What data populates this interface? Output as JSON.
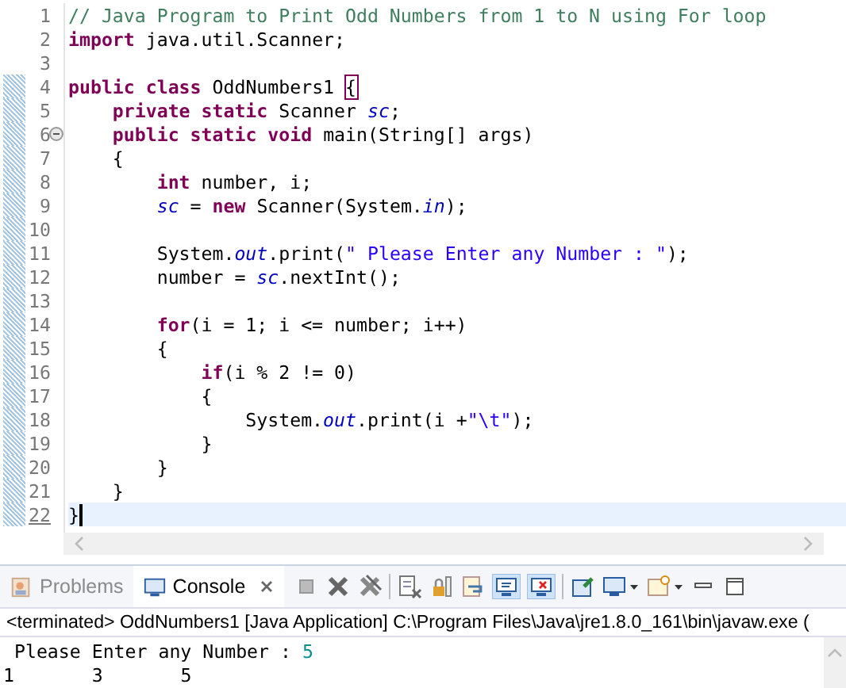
{
  "editor": {
    "lines": [
      {
        "number": "1",
        "changed": false,
        "current": false,
        "tokens": [
          {
            "kind": "comment",
            "text": "// Java Program to Print Odd Numbers from 1 to N using For loop"
          }
        ]
      },
      {
        "number": "2",
        "changed": false,
        "current": false,
        "tokens": [
          {
            "kind": "keyword",
            "text": "import"
          },
          {
            "kind": "plain",
            "text": " java.util.Scanner;"
          }
        ]
      },
      {
        "number": "3",
        "changed": false,
        "current": false
      },
      {
        "number": "4",
        "changed": true,
        "current": false,
        "tokens": [
          {
            "kind": "keyword",
            "text": "public"
          },
          {
            "kind": "keyword",
            "text": " class"
          },
          {
            "kind": "plain",
            "text": " OddNumbers1 "
          },
          {
            "kind": "bracket-match",
            "text": "{"
          }
        ]
      },
      {
        "number": "5",
        "changed": true,
        "current": false,
        "tokens": [
          {
            "kind": "keyword",
            "text": "    private"
          },
          {
            "kind": "keyword",
            "text": " static"
          },
          {
            "kind": "plain",
            "text": " Scanner "
          },
          {
            "kind": "field",
            "text": "sc"
          },
          {
            "kind": "plain",
            "text": ";"
          }
        ]
      },
      {
        "number": "6",
        "changed": true,
        "current": false,
        "expanded": true,
        "tokens": [
          {
            "kind": "keyword",
            "text": "    public"
          },
          {
            "kind": "keyword",
            "text": " static"
          },
          {
            "kind": "keyword",
            "text": " void"
          },
          {
            "kind": "plain",
            "text": " main(String[] args)"
          }
        ]
      },
      {
        "number": "7",
        "changed": true,
        "current": false,
        "tokens": [
          {
            "kind": "plain",
            "text": "    {"
          }
        ]
      },
      {
        "number": "8",
        "changed": true,
        "current": false,
        "tokens": [
          {
            "kind": "keyword",
            "text": "        int"
          },
          {
            "kind": "plain",
            "text": " number, i;"
          }
        ]
      },
      {
        "number": "9",
        "changed": true,
        "current": false,
        "tokens": [
          {
            "kind": "field",
            "text": "        sc"
          },
          {
            "kind": "plain",
            "text": " = "
          },
          {
            "kind": "keyword",
            "text": "new"
          },
          {
            "kind": "plain",
            "text": " Scanner(System."
          },
          {
            "kind": "field",
            "text": "in"
          },
          {
            "kind": "plain",
            "text": ");"
          }
        ]
      },
      {
        "number": "10",
        "changed": true,
        "current": false
      },
      {
        "number": "11",
        "changed": true,
        "current": false,
        "tokens": [
          {
            "kind": "plain",
            "text": "        System."
          },
          {
            "kind": "field",
            "text": "out"
          },
          {
            "kind": "plain",
            "text": ".print("
          },
          {
            "kind": "string",
            "text": "\" Please Enter any Number : \""
          },
          {
            "kind": "plain",
            "text": ");"
          }
        ]
      },
      {
        "number": "12",
        "changed": true,
        "current": false,
        "tokens": [
          {
            "kind": "plain",
            "text": "        number = "
          },
          {
            "kind": "field",
            "text": "sc"
          },
          {
            "kind": "plain",
            "text": ".nextInt();"
          }
        ]
      },
      {
        "number": "13",
        "changed": true,
        "current": false
      },
      {
        "number": "14",
        "changed": true,
        "current": false,
        "tokens": [
          {
            "kind": "keyword",
            "text": "        for"
          },
          {
            "kind": "plain",
            "text": "(i = 1; i <= number; i++)"
          }
        ]
      },
      {
        "number": "15",
        "changed": true,
        "current": false,
        "tokens": [
          {
            "kind": "plain",
            "text": "        {"
          }
        ]
      },
      {
        "number": "16",
        "changed": true,
        "current": false,
        "tokens": [
          {
            "kind": "keyword",
            "text": "            if"
          },
          {
            "kind": "plain",
            "text": "(i % 2 != 0)"
          }
        ]
      },
      {
        "number": "17",
        "changed": true,
        "current": false,
        "tokens": [
          {
            "kind": "plain",
            "text": "            {"
          }
        ]
      },
      {
        "number": "18",
        "changed": true,
        "current": false,
        "tokens": [
          {
            "kind": "plain",
            "text": "                System."
          },
          {
            "kind": "field",
            "text": "out"
          },
          {
            "kind": "plain",
            "text": ".print(i +"
          },
          {
            "kind": "string",
            "text": "\"\\t\""
          },
          {
            "kind": "plain",
            "text": ");"
          }
        ]
      },
      {
        "number": "19",
        "changed": true,
        "current": false,
        "tokens": [
          {
            "kind": "plain",
            "text": "            }"
          }
        ]
      },
      {
        "number": "20",
        "changed": true,
        "current": false,
        "tokens": [
          {
            "kind": "plain",
            "text": "        }"
          }
        ]
      },
      {
        "number": "21",
        "changed": true,
        "current": false,
        "tokens": [
          {
            "kind": "plain",
            "text": "    }"
          }
        ]
      },
      {
        "number": "22",
        "changed": true,
        "current": true,
        "tokens": [
          {
            "kind": "plain",
            "text": "}"
          }
        ]
      }
    ]
  },
  "console": {
    "tabs": [
      {
        "label": "Problems",
        "selected": false
      },
      {
        "label": "Console",
        "selected": true
      }
    ],
    "toggles": [
      {
        "selected": true
      },
      {
        "selected": true
      }
    ],
    "header": "<terminated> OddNumbers1 [Java Application] C:\\Program Files\\Java\\jre1.8.0_161\\bin\\javaw.exe (",
    "output": [
      {
        "kind": "prompt",
        "text": " Please Enter any Number : ",
        "input": "5"
      },
      {
        "kind": "plain",
        "text": "1\t3\t5"
      }
    ]
  }
}
